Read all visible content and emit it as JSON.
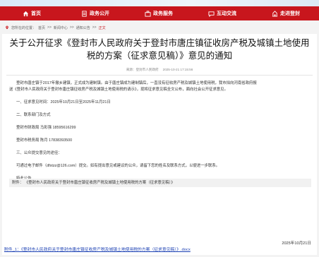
{
  "nav": {
    "items": [
      {
        "label": "首页",
        "icon": "home-icon"
      },
      {
        "label": "政务公开",
        "icon": "document-icon"
      },
      {
        "label": "政务服务",
        "icon": "service-icon"
      },
      {
        "label": "互动交流",
        "icon": "chat-icon"
      },
      {
        "label": "走进登封",
        "icon": "building-icon"
      }
    ]
  },
  "breadcrumb": {
    "prefix": "您所在的位置：",
    "items": [
      "首页",
      "新闻中心",
      "通知公告"
    ],
    "separator": ">>",
    "current": "正文"
  },
  "article": {
    "title": "关于公开征求《登封市人民政府关于登封市唐庄镇征收房产税及城镇土地使用税的方案（征求意见稿）》意见的通知",
    "meta_source": "来源：登封市人民政府",
    "meta_date": "2025-10-21 17:15:56",
    "para1_line1": "登封市唐庄镇于2017年撤乡建镇，正式成为建制镇。由于唐庄镇成为建制镇后，一直没有征收房产税及城镇土地使用税，我市拟向河南省政府报",
    "para1_line2": "送《登封市人民政府关于登封市唐庄镇征收房产税及城镇土地使用税的请示》，现将征求意见稿全文公布，面向社会公开征求意见。",
    "section1": "一、征求意见时间：2025年10月21日至2025年11月21日",
    "section2": "二、联系部门及方式",
    "contact1": "登封市财政局  马彩强  18595616299",
    "contact2": "登封市税务局  陈月  17838393500",
    "section3": "三、公众提交意见的途径：",
    "email_line": "可通过电子邮件（dfstzz@126.com）提交。如有提出意见或建议的公众，请留下您的姓名及联系方式，以便进一步联系。",
    "notice": "特此公告",
    "attachment_label": "附件：",
    "attachment_name": "《登封市人民政府关于登封市唐庄镇征收房产税及城镇土地使用税的方案（征求意见稿）》",
    "date": "2025年10月21日"
  },
  "footer": {
    "attachment_link": "附件_1：《登封市人民政府关于登封市唐庄镇征收房产税及城镇土地使用税的方案（征求意见稿）》.docx"
  },
  "colors": {
    "nav_red": "#c8161d",
    "link_blue": "#1a3fb3"
  }
}
